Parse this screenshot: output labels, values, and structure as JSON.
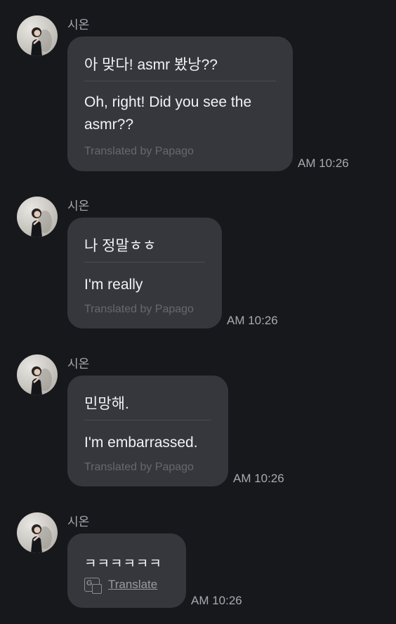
{
  "messages": [
    {
      "sender": "시온",
      "original": "아 맞다! asmr 봤낭??",
      "translation": "Oh, right! Did you see the asmr??",
      "credit": "Translated by Papago",
      "time": "AM 10:26"
    },
    {
      "sender": "시온",
      "original": "나 정말ㅎㅎ",
      "translation": "I'm really",
      "credit": "Translated by Papago",
      "time": "AM 10:26"
    },
    {
      "sender": "시온",
      "original": "민망해.",
      "translation": "I'm embarrassed.",
      "credit": "Translated by Papago",
      "time": "AM 10:26"
    },
    {
      "sender": "시온",
      "original": "ㅋㅋㅋㅋㅋㅋ",
      "translate_label": "Translate",
      "translate_icon": "translate-icon",
      "time": "AM 10:26"
    }
  ],
  "colors": {
    "background": "#17181c",
    "bubble": "#36373d",
    "text": "#f2f2f4",
    "muted": "#a9aab0",
    "credit": "#67686e"
  }
}
